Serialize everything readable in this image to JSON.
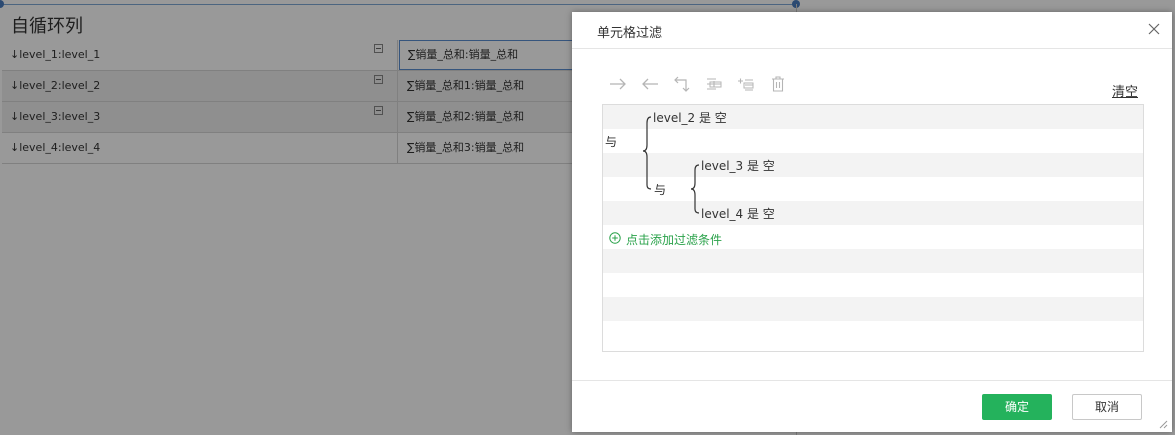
{
  "sheet": {
    "title": "自循环列",
    "rows": [
      {
        "label": "↓level_1:level_1",
        "value": "∑销量_总和:销量_总和",
        "collapsible": true
      },
      {
        "label": "↓level_2:level_2",
        "value": "∑销量_总和1:销量_总和",
        "collapsible": true
      },
      {
        "label": "↓level_3:level_3",
        "value": "∑销量_总和2:销量_总和",
        "collapsible": true
      },
      {
        "label": "↓level_4:level_4",
        "value": "∑销量_总和3:销量_总和",
        "collapsible": false
      }
    ]
  },
  "dialog": {
    "title": "单元格过滤",
    "toolbar": {
      "icons": [
        "indent-arrow-icon",
        "outdent-arrow-icon",
        "move-level-icon",
        "add-sibling-icon",
        "add-child-icon",
        "delete-icon"
      ]
    },
    "clear_label": "清空",
    "conditions": {
      "root_operator": "与",
      "condition_1": "level_2 是 空",
      "nested_operator": "与",
      "condition_2": "level_3 是 空",
      "condition_3": "level_4 是 空"
    },
    "add_condition_label": "点击添加过滤条件",
    "ok_label": "确定",
    "cancel_label": "取消"
  },
  "colors": {
    "accent_green": "#24b25c",
    "link_green": "#2aa24a",
    "selection_blue": "#4a7cbf"
  }
}
